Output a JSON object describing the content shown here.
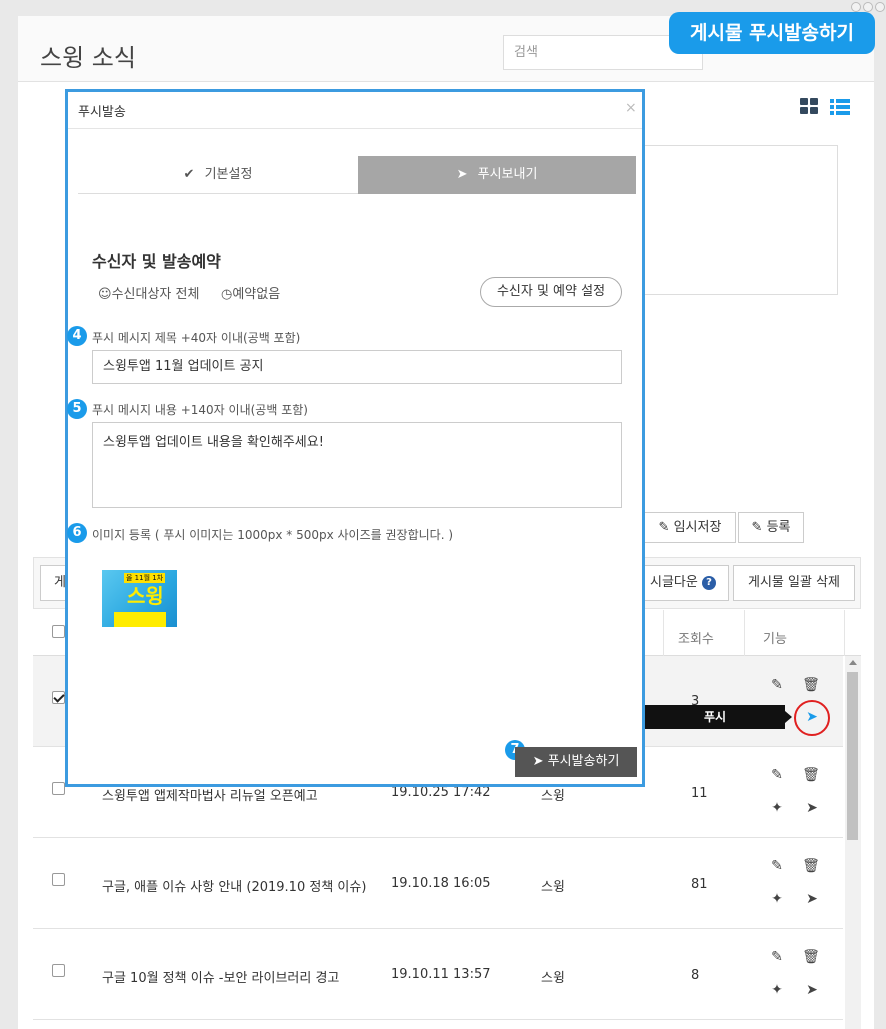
{
  "page": {
    "title": "스윙 소식",
    "search_placeholder": "검색"
  },
  "banner": {
    "text": "게시물 푸시발송하기"
  },
  "editor": {
    "temp_save_label": "임시저장",
    "register_label": "등록"
  },
  "list_toolbar": {
    "select_label": "게",
    "download_label": "시글다운",
    "help_icon": "?",
    "bulk_delete_label": "게시물 일괄 삭제"
  },
  "table": {
    "headers": {
      "views": "조회수",
      "actions": "기능"
    },
    "rows": [
      {
        "checked": true,
        "title": "",
        "date": "",
        "author": "",
        "views": "3"
      },
      {
        "checked": false,
        "title": "스윙투앱 앱제작마법사 리뉴얼 오픈예고",
        "date": "19.10.25 17:42",
        "author": "스윙",
        "views": "11"
      },
      {
        "checked": false,
        "title": "구글, 애플 이슈 사항 안내 (2019.10 정책 이슈)",
        "date": "19.10.18 16:05",
        "author": "스윙",
        "views": "81"
      },
      {
        "checked": false,
        "title": "구글 10월 정책 이슈 -보안 라이브러리 경고",
        "date": "19.10.11 13:57",
        "author": "스윙",
        "views": "8"
      }
    ]
  },
  "tooltip": {
    "text": "푸시"
  },
  "modal": {
    "title": "푸시발송",
    "close": "×",
    "tabs": [
      {
        "label": "기본설정",
        "icon": "check-icon"
      },
      {
        "label": "푸시보내기",
        "icon": "paper-plane-icon"
      }
    ],
    "section_title": "수신자 및 발송예약",
    "recipient": "수신대상자 전체",
    "schedule": "예약없음",
    "recipient_button": "수신자 및 예약 설정",
    "steps": {
      "s4": "4",
      "s5": "5",
      "s6": "6",
      "s7": "7"
    },
    "title_label": "푸시 메시지 제목 +40자 이내(공백 포함)",
    "title_value": "스윙투앱 11월 업데이트 공지",
    "body_label": "푸시 메시지 내용 +140자 이내(공백 포함)",
    "body_value": "스윙투앱 업데이트 내용을 확인해주세요!",
    "image_label": "이미지 등록 ( 푸시 이미지는 1000px * 500px 사이즈를 권장합니다. )",
    "image_thumb": {
      "top_text": "올 11월 1차",
      "main_text": "스윙"
    },
    "send_button": "푸시발송하기"
  },
  "colors": {
    "accent": "#1a9bea",
    "modal_border": "#3c9be0",
    "tab_active": "#a6a6a6",
    "send_button": "#555555",
    "highlight_ring": "#e02020"
  }
}
